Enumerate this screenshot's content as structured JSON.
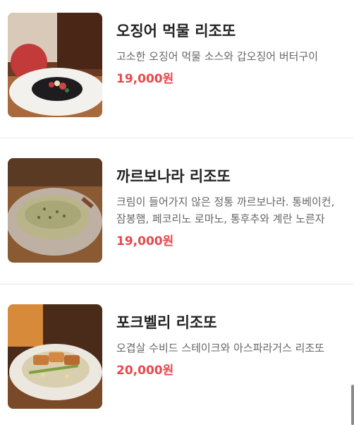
{
  "menu": {
    "items": [
      {
        "name": "오징어 먹물 리조또",
        "description": "고소한 오징어 먹물 소스와 갑오징어 버터구이",
        "price": "19,000원"
      },
      {
        "name": "까르보나라 리조또",
        "description": "크림이 들어가지 않은 정통 까르보나라. 통베이컨, 잠봉햄, 페코리노 로마노, 통후추와 계란 노른자",
        "price": "19,000원"
      },
      {
        "name": "포크벨리 리조또",
        "description": "오겹살 수비드 스테이크와 아스파라거스 리조또",
        "price": "20,000원"
      }
    ]
  },
  "colors": {
    "price": "#e8484d",
    "title": "#222222",
    "description": "#666666"
  }
}
